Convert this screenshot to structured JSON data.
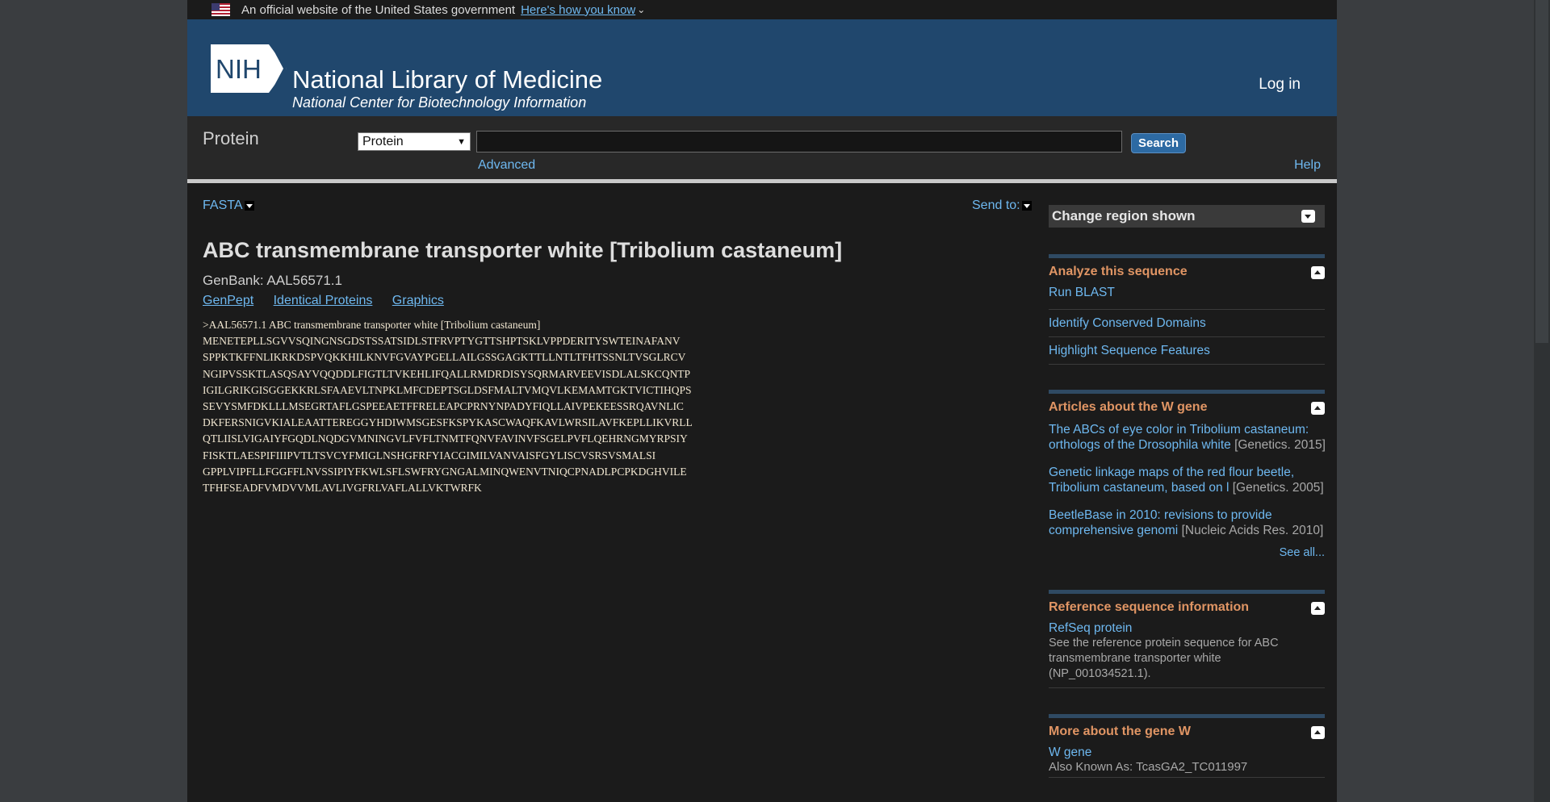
{
  "gov_banner": {
    "text": "An official website of the United States government",
    "link": "Here's how you know"
  },
  "header": {
    "logo_text": "NIH",
    "title": "National Library of Medicine",
    "subtitle": "National Center for Biotechnology Information",
    "login": "Log in"
  },
  "searchbar": {
    "db_title": "Protein",
    "db_selected": "Protein",
    "search_value": "",
    "search_button": "Search",
    "advanced": "Advanced",
    "help": "Help"
  },
  "record": {
    "format": "FASTA",
    "send_to": "Send to:",
    "title": "ABC transmembrane transporter white [Tribolium castaneum]",
    "genbank": "GenBank: AAL56571.1",
    "links": [
      "GenPept",
      "Identical Proteins",
      "Graphics"
    ],
    "fasta_header": ">AAL56571.1 ABC transmembrane transporter white [Tribolium castaneum]",
    "sequence_lines": [
      "MENETEPLLSGVVSQINGNSGDSTSSATSIDLSTFRVPTYGTTSHPTSKLVPPDERITYSWTEINAFANV",
      "SPPKTKFFNLIKRKDSPVQKKHILKNVFGVAYPGELLAILGSSGAGKTTLLNTLTFHTSSNLTVSGLRCV",
      "NGIPVSSKTLASQSAYVQQDDLFIGTLTVKEHLIFQALLRMDRDISYSQRMARVEEVISDLALSKCQNTP",
      "IGILGRIKGISGGEKKRLSFAAEVLTNPKLMFCDEPTSGLDSFMALTVMQVLKEMAMTGKTVICTIHQPS",
      "SEVYSMFDKLLLMSEGRTAFLGSPEEAETFFRELEAPCPRNYNPADYFIQLLAIVPEKEESSRQAVNLIC",
      "DKFERSNIGVKIALEAATTEREGGYHDIWMSGESFKSPYKASCWAQFKAVLWRSILAVFKEPLLIKVRLL",
      "QTLIISLVIGAIYFGQDLNQDGVMNINGVLFVFLTNMTFQNVFAVINVFSGELPVFLQEHRNGMYRPSIY",
      "FISKTLAESPIFIIIPVTLTSVCYFMIGLNSHGFRFYIACGIMILVANVAISFGYLISCVSRSVSMALSI",
      "GPPLVIPFLLFGGFFLNVSSIPIYFKWLSFLSWFRYGNGALMINQWENVTNIQCPNADLPCPKDGHVILE",
      "TFHFSEADFVMDVVMLAVLIVGFRLVAFLALLVKTWRFK"
    ]
  },
  "sidebar": {
    "change_region": "Change region shown",
    "analyze": {
      "title": "Analyze this sequence",
      "items": [
        "Run BLAST",
        "Identify Conserved Domains",
        "Highlight Sequence Features"
      ]
    },
    "articles": {
      "title": "Articles about the W gene",
      "items": [
        {
          "line1": "The ABCs of eye color in Tribolium castaneum:",
          "line2": "orthologs of the Drosophila white",
          "source": "[Genetics. 2015]"
        },
        {
          "line1": "Genetic linkage maps of the red flour beetle,",
          "line2": "Tribolium castaneum, based on l",
          "source": "[Genetics. 2005]"
        },
        {
          "line1": "BeetleBase in 2010: revisions to provide",
          "line2": "comprehensive genomi",
          "source": "[Nucleic Acids Res. 2010]"
        }
      ],
      "see_all": "See all..."
    },
    "refseq": {
      "title": "Reference sequence information",
      "link": "RefSeq protein",
      "desc": "See the reference protein sequence for ABC transmembrane transporter white (NP_001034521.1)."
    },
    "more_gene": {
      "title": "More about the gene W",
      "link": "W gene",
      "aka": "Also Known As: TcasGA2_TC011997"
    }
  }
}
